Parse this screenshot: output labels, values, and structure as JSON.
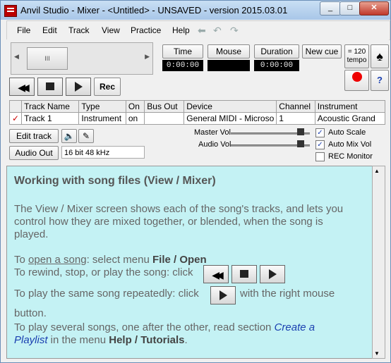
{
  "window": {
    "title": "Anvil Studio - Mixer - <Untitled> - UNSAVED - version 2015.03.01"
  },
  "menu": {
    "items": [
      "File",
      "Edit",
      "Track",
      "View",
      "Practice",
      "Help"
    ]
  },
  "transport": {
    "time_label": "Time",
    "time_value": "0:00:00",
    "mouse_label": "Mouse",
    "mouse_value": "",
    "duration_label": "Duration",
    "duration_value": "0:00:00",
    "newcue_label": "New cue",
    "tempo_label": "= 120 tempo",
    "rec_label": "Rec",
    "slider_grip": "III"
  },
  "track_table": {
    "headers": [
      "",
      "Track Name",
      "Type",
      "On",
      "Bus Out",
      "Device",
      "Channel",
      "Instrument"
    ],
    "rows": [
      {
        "check": "✓",
        "name": "Track 1",
        "type": "Instrument",
        "on": "on",
        "bus": "",
        "device": "General MIDI - Microso",
        "channel": "1",
        "instrument": "Acoustic Grand"
      }
    ]
  },
  "controls": {
    "edit_track": "Edit track",
    "audio_out": "Audio Out",
    "audio_format": "16 bit 48 kHz",
    "master_vol": "Master Vol",
    "audio_vol": "Audio Vol",
    "auto_scale": "Auto Scale",
    "auto_mix_vol": "Auto Mix Vol",
    "rec_monitor": "REC Monitor"
  },
  "help": {
    "heading": "Working with song files (View / Mixer)",
    "p1a": "The View / Mixer screen shows each of the song's tracks, and lets you",
    "p1b": "control how they are mixed together, or blended, when the song is",
    "p1c": "played.",
    "l1_pre": "To ",
    "l1_link": "open a song",
    "l1_mid": ": select menu ",
    "l1_bold": "File / Open",
    "l2": "To rewind, stop, or play the song: click",
    "l3_pre": "To play the same song repeatedly: click",
    "l3_post": "with the right mouse",
    "l4": "button.",
    "l5_pre": "To play several songs, one after the other, read section ",
    "l5_link": "Create a",
    "l6_link": "Playlist",
    "l6_mid": " in the menu ",
    "l6_bold": "Help / Tutorials",
    "l6_end": "."
  },
  "colors": {
    "help_bg": "#c4f2f4",
    "link": "#1a3fb0",
    "lcd_bg": "#000000"
  }
}
